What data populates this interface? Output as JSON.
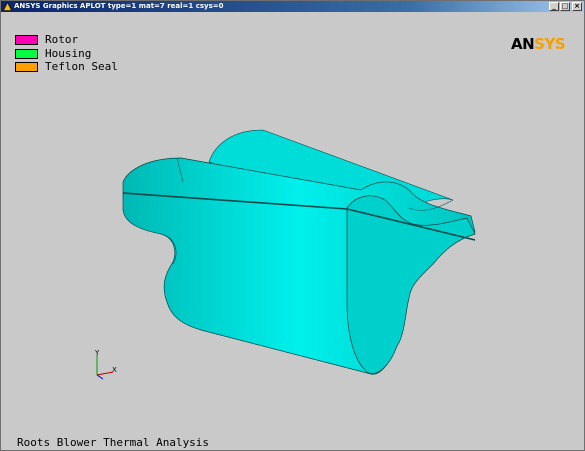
{
  "window": {
    "title": "ANSYS Graphics   APLOT  type=1 mat=7 real=1 csys=0",
    "minimize_glyph": "_",
    "maximize_glyph": "□",
    "close_glyph": "×"
  },
  "legend": {
    "items": [
      {
        "label": "Rotor",
        "color": "#ff00b4"
      },
      {
        "label": "Housing",
        "color": "#00ff40"
      },
      {
        "label": "Teflon Seal",
        "color": "#ffa000"
      }
    ]
  },
  "logo": {
    "part1": "AN",
    "part2": "SYS"
  },
  "triad": {
    "y_label": "Y",
    "x_label": "X"
  },
  "footer": {
    "title": "Roots Blower Thermal Analysis"
  },
  "colors": {
    "background": "#c9c9c9",
    "model_fill": "#00e0dc",
    "model_dark": "#00a8a8",
    "logo_accent": "#f5a000"
  }
}
